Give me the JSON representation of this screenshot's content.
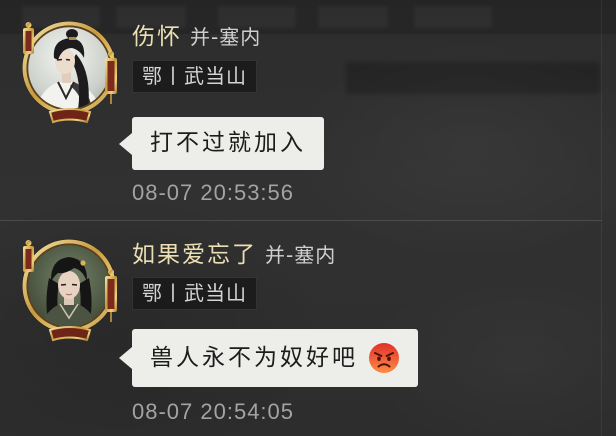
{
  "colors": {
    "background": "#2e2e2e",
    "name": "#ecdfb4",
    "server": "#cfcfcf",
    "tag_text": "#d4d4d4",
    "bubble_bg": "#ededea",
    "bubble_text": "#1c1c1c",
    "timestamp": "#a3a3a3"
  },
  "messages": [
    {
      "avatar_icon": "male-character-avatar",
      "name": "伤怀",
      "server": "并-塞内",
      "tag": "鄂丨武当山",
      "text": "打不过就加入",
      "time": "08-07 20:53:56"
    },
    {
      "avatar_icon": "female-character-avatar",
      "name": "如果爱忘了",
      "server": "并-塞内",
      "tag": "鄂丨武当山",
      "text": "兽人永不为奴好吧",
      "emoji_icon": "angry-face",
      "time": "08-07 20:54:05"
    }
  ]
}
